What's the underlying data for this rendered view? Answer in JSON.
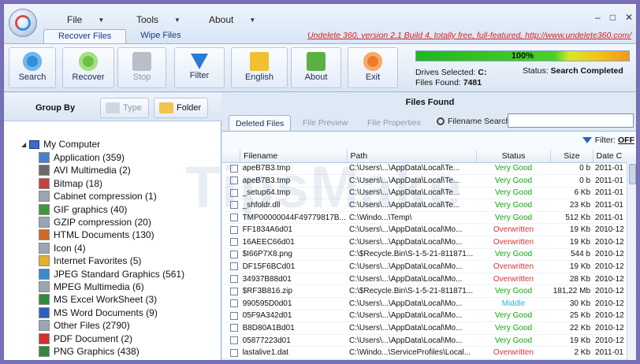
{
  "menu": {
    "file": "File",
    "tools": "Tools",
    "about": "About"
  },
  "window_controls": {
    "minimize": "–",
    "maximize": "□",
    "close": "✕"
  },
  "ribbon_tabs": [
    "Recover Files",
    "Wipe Files"
  ],
  "banner_link": "Undelete 360, version 2.1 Build 4, totally free, full-featured, http://www.undelete360.com/",
  "toolbar": {
    "search": "Search",
    "recover": "Recover",
    "stop": "Stop",
    "filter": "Filter",
    "language": "English",
    "about": "About",
    "exit": "Exit"
  },
  "status": {
    "progress_percent": 100,
    "progress_label": "100%",
    "drives_label": "Drives Selected:",
    "drives_value": "C:",
    "status_label": "Status:",
    "status_value": "Search Completed",
    "files_label": "Files Found:",
    "files_value": "7481"
  },
  "group_by": {
    "label": "Group By",
    "type": "Type",
    "folder": "Folder"
  },
  "tree": {
    "root": "My Computer",
    "items": [
      "Application (359)",
      "AVI Multimedia (2)",
      "Bitmap (18)",
      "Cabinet compression (1)",
      "GIF graphics (40)",
      "GZIP compression (20)",
      "HTML Documents (130)",
      "Icon (4)",
      "Internet Favorites (5)",
      "JPEG Standard Graphics (561)",
      "MPEG Multimedia (6)",
      "MS Excel WorkSheet (3)",
      "MS Word Documents (9)",
      "Other Files (2790)",
      "PDF Document (2)",
      "PNG Graphics (438)"
    ]
  },
  "files_found_title": "Files Found",
  "tabs": [
    "Deleted Files",
    "File Preview",
    "File Properties"
  ],
  "search": {
    "label": "Filename Search",
    "value": ""
  },
  "filter_label": "Filter:",
  "filter_value": "OFF",
  "columns": [
    "Filename",
    "Path",
    "Status",
    "Size",
    "Date C"
  ],
  "rows": [
    [
      "apeB7B3.tmp",
      "C:\\Users\\...\\AppData\\Local\\Te...",
      "Very Good",
      "0 b",
      "2011-01"
    ],
    [
      "apeB7B3.tmp",
      "C:\\Users\\...\\AppData\\Local\\Te...",
      "Very Good",
      "0 b",
      "2011-01"
    ],
    [
      "_setup64.tmp",
      "C:\\Users\\...\\AppData\\Local\\Te...",
      "Very Good",
      "6 Kb",
      "2011-01"
    ],
    [
      "_shfoldr.dll",
      "C:\\Users\\...\\AppData\\Local\\Te...",
      "Very Good",
      "23 Kb",
      "2011-01"
    ],
    [
      "TMP00000044F49779817B...",
      "C:\\Windo...\\Temp\\",
      "Very Good",
      "512 Kb",
      "2011-01"
    ],
    [
      "FF1834A6d01",
      "C:\\Users\\...\\AppData\\Local\\Mo...",
      "Overwritten",
      "19 Kb",
      "2010-12"
    ],
    [
      "16AEEC66d01",
      "C:\\Users\\...\\AppData\\Local\\Mo...",
      "Overwritten",
      "19 Kb",
      "2010-12"
    ],
    [
      "$I66P7X8.png",
      "C:\\$Recycle.Bin\\S-1-5-21-811871...",
      "Very Good",
      "544 b",
      "2010-12"
    ],
    [
      "DF15F6BCd01",
      "C:\\Users\\...\\AppData\\Local\\Mo...",
      "Overwritten",
      "19 Kb",
      "2010-12"
    ],
    [
      "34937B88d01",
      "C:\\Users\\...\\AppData\\Local\\Mo...",
      "Overwritten",
      "28 Kb",
      "2010-12"
    ],
    [
      "$RF3B816.zip",
      "C:\\$Recycle.Bin\\S-1-5-21-811871...",
      "Very Good",
      "181,22 Mb",
      "2010-12"
    ],
    [
      "990595D0d01",
      "C:\\Users\\...\\AppData\\Local\\Mo...",
      "Middle",
      "30 Kb",
      "2010-12"
    ],
    [
      "05F9A342d01",
      "C:\\Users\\...\\AppData\\Local\\Mo...",
      "Very Good",
      "25 Kb",
      "2010-12"
    ],
    [
      "B8D80A1Bd01",
      "C:\\Users\\...\\AppData\\Local\\Mo...",
      "Very Good",
      "22 Kb",
      "2010-12"
    ],
    [
      "05877223d01",
      "C:\\Users\\...\\AppData\\Local\\Mo...",
      "Very Good",
      "19 Kb",
      "2010-12"
    ],
    [
      "lastalive1.dat",
      "C:\\Windo...\\ServiceProfiles\\Local...",
      "Overwritten",
      "2 Kb",
      "2011-01"
    ]
  ],
  "status_colors": {
    "Very Good": "#10a810",
    "Overwritten": "#e03030",
    "Middle": "#2ab0e0"
  },
  "watermark": "TipsMake"
}
